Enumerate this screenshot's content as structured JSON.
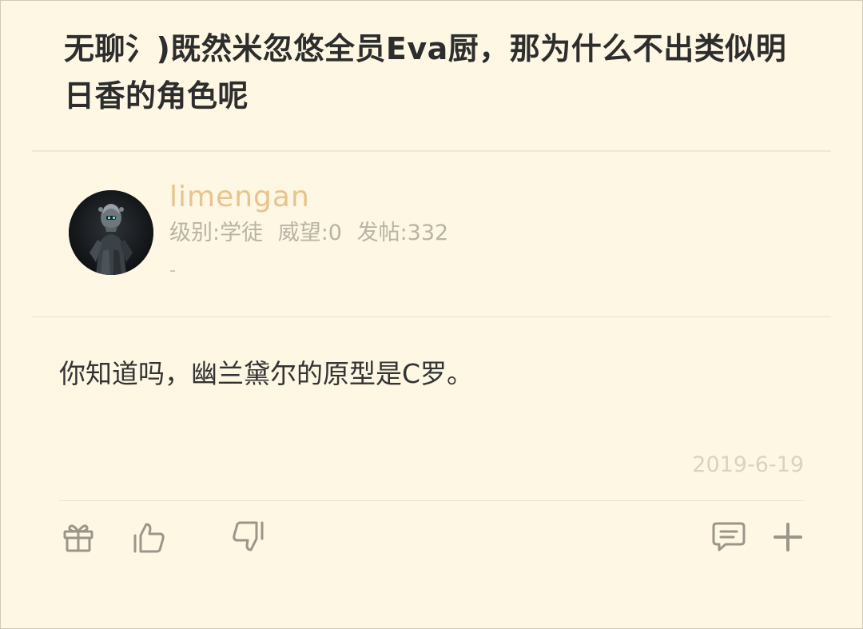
{
  "post": {
    "title": "无聊氵)既然米忽悠全员Eva厨，那为什么不出类似明日香的角色呢",
    "content": "你知道吗，幽兰黛尔的原型是C罗。",
    "date": "2019-6-19"
  },
  "author": {
    "name": "limengan",
    "level": "级别:学徒",
    "prestige": "威望:0",
    "posts": "发帖:332",
    "signature": "-"
  },
  "actions": {
    "icons": [
      "gift-icon",
      "thumbs-up-icon",
      "thumbs-down-icon",
      "comment-icon",
      "plus-icon"
    ]
  },
  "colors": {
    "background": "#fdf7e3",
    "username": "#e8c38d",
    "icon": "#9a968a"
  }
}
